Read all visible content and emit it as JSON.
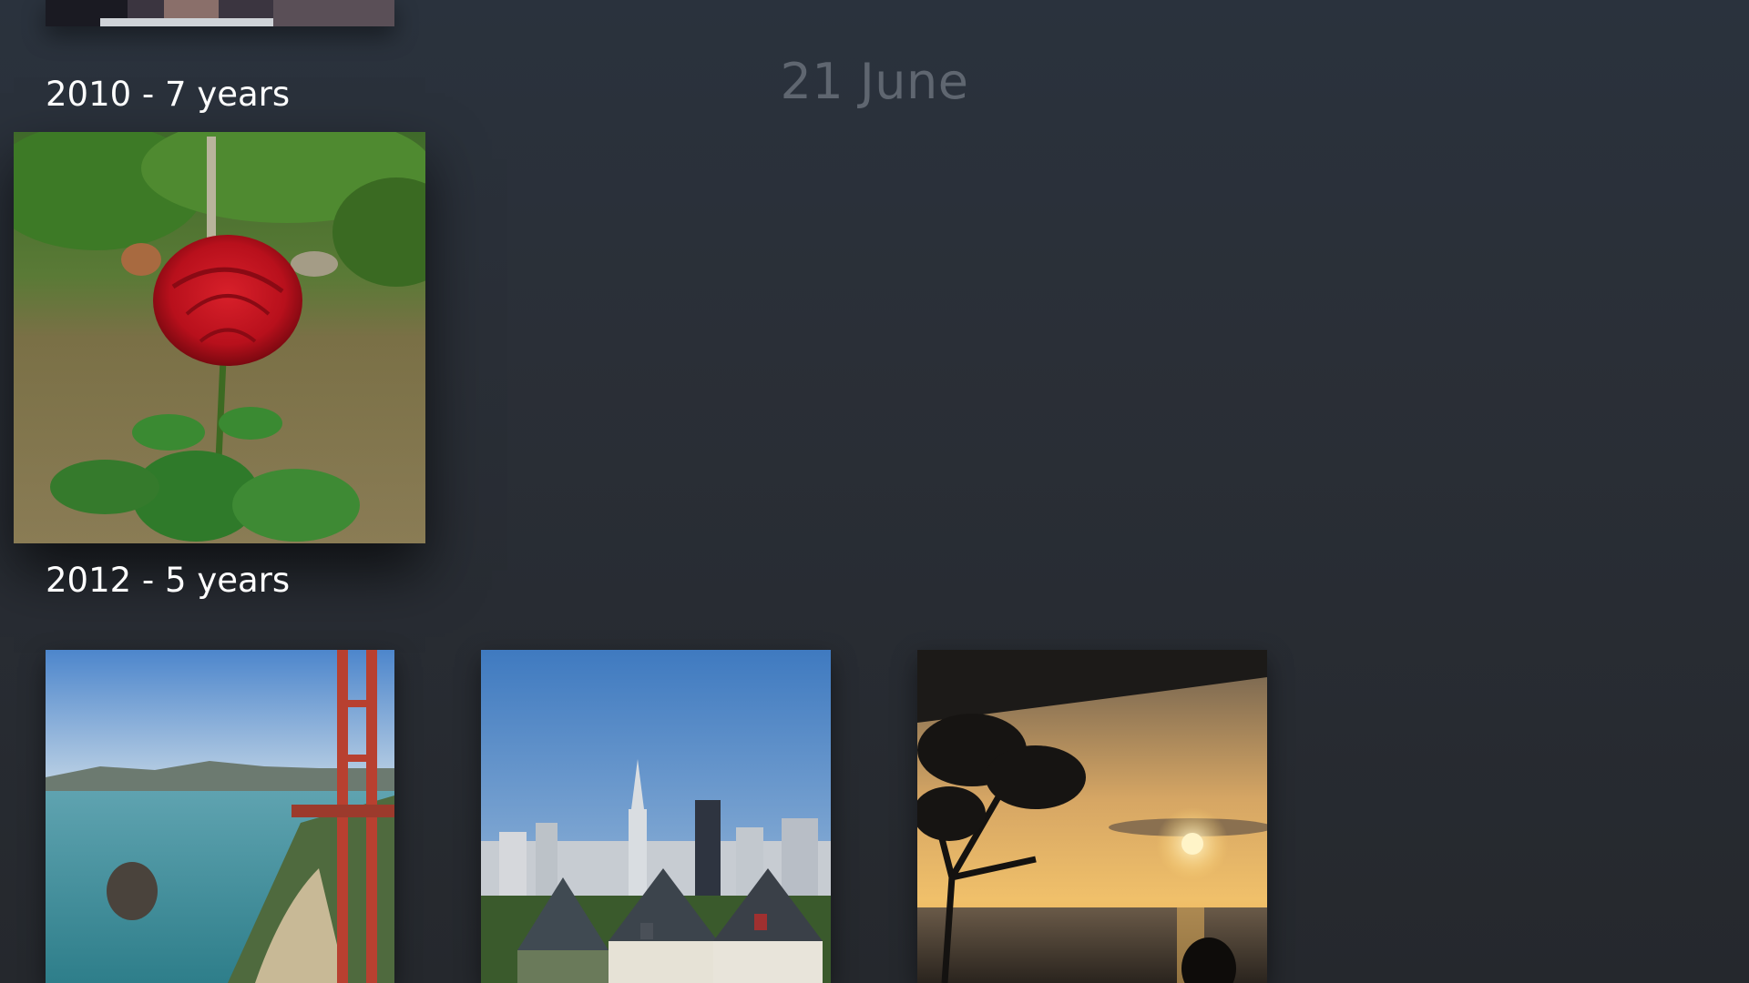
{
  "header": {
    "title": "21 June"
  },
  "sections": [
    {
      "label": "2010 - 7 years"
    },
    {
      "label": "2012 - 5 years"
    }
  ],
  "photos": [
    {
      "name": "partial photo (top cropped)"
    },
    {
      "name": "red rose"
    },
    {
      "name": "golden gate bridge"
    },
    {
      "name": "painted ladies skyline"
    },
    {
      "name": "sunset over water"
    }
  ],
  "colors": {
    "background_top": "#2a323d",
    "background_bottom": "#25282d",
    "title": "#5f6670",
    "label": "#ffffff"
  }
}
